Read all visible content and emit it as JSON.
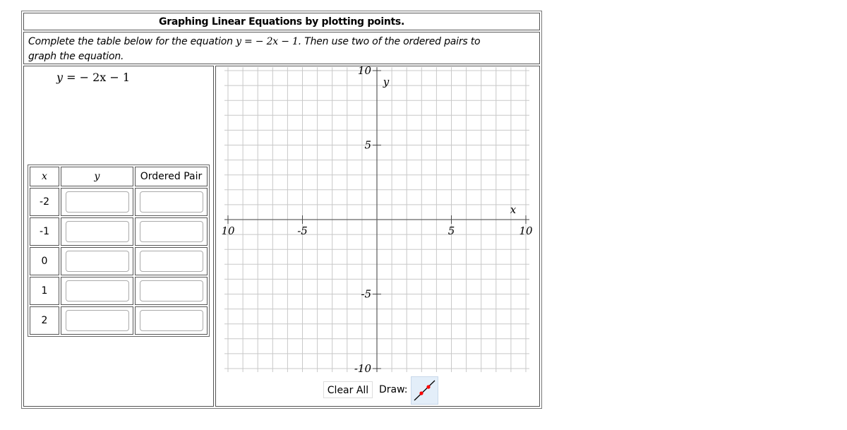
{
  "header": {
    "title": "Graphing Linear Equations by plotting points."
  },
  "instructions": {
    "prefix": "Complete the table below for the equation ",
    "equation": "y =  − 2x − 1",
    "suffix": ". Then use two of the ordered pairs to graph the equation."
  },
  "equation_display": {
    "lhs": "y",
    "rhs": "=  − 2x − 1"
  },
  "table": {
    "headers": [
      "x",
      "y",
      "Ordered Pair"
    ],
    "rows": [
      {
        "x": "-2",
        "y": "",
        "pair": ""
      },
      {
        "x": "-1",
        "y": "",
        "pair": ""
      },
      {
        "x": "0",
        "y": "",
        "pair": ""
      },
      {
        "x": "1",
        "y": "",
        "pair": ""
      },
      {
        "x": "2",
        "y": "",
        "pair": ""
      }
    ]
  },
  "graph": {
    "x_axis_label": "x",
    "y_axis_label": "y",
    "x_range": [
      -10,
      10
    ],
    "y_range": [
      -10,
      10
    ],
    "grid_step": 1,
    "x_tick_labels": [
      {
        "value": -10,
        "text": "10"
      },
      {
        "value": -5,
        "text": "-5"
      },
      {
        "value": 5,
        "text": "5"
      },
      {
        "value": 10,
        "text": "10"
      }
    ],
    "y_tick_labels": [
      {
        "value": 10,
        "text": "10"
      },
      {
        "value": 5,
        "text": "5"
      },
      {
        "value": -5,
        "text": "-5"
      },
      {
        "value": -10,
        "text": "-10"
      }
    ],
    "colors": {
      "grid": "#c8c8c8",
      "axis": "#666666",
      "point": "#ff0000"
    }
  },
  "controls": {
    "clear_all_label": "Clear All",
    "draw_label": "Draw:",
    "draw_tool_icon": "line-through-two-points-icon"
  }
}
